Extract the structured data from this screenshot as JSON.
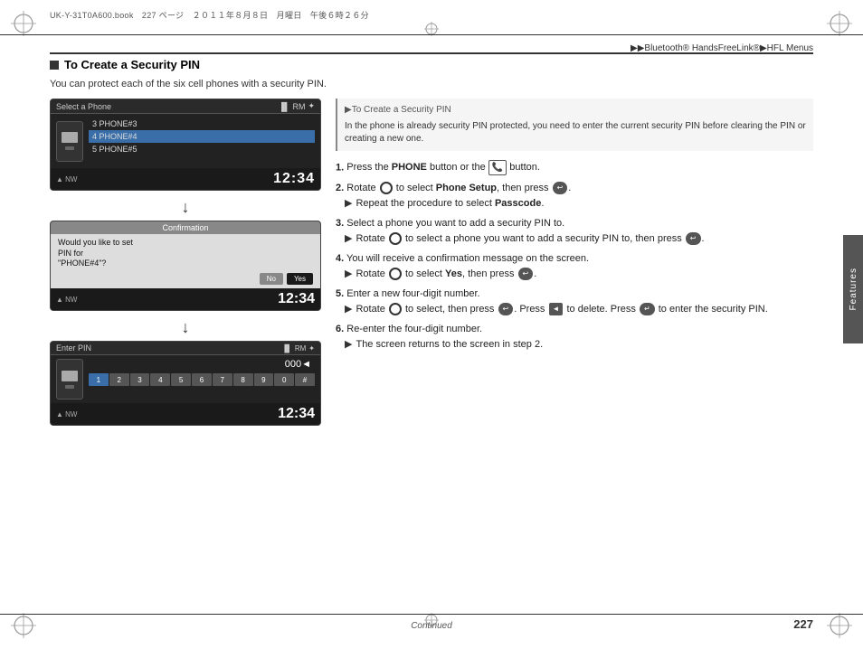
{
  "page": {
    "file_path": "UK-Y-31T0A600.book　227 ページ　２０１１年８月８日　月曜日　午後６時２６分",
    "header_breadcrumb": "▶▶Bluetooth® HandsFreeLink®▶HFL Menus",
    "page_number": "227",
    "continued_label": "Continued"
  },
  "section": {
    "title": "To Create a Security PIN",
    "intro": "You can protect each of the six cell phones with a security PIN."
  },
  "side_note": {
    "title": "▶To Create a Security PIN",
    "body": "In the phone is already security PIN protected, you need to enter the current security PIN before clearing the PIN or creating a new one."
  },
  "screens": {
    "select_phone": {
      "title": "Select a Phone",
      "icons_right": "RM Bluetooth",
      "items": [
        {
          "label": "3 PHONE#3",
          "selected": false
        },
        {
          "label": "4 PHONE#4",
          "selected": true
        },
        {
          "label": "5 PHONE#5",
          "selected": false
        }
      ],
      "footer_nav": "▲ NW",
      "footer_time": "12:34"
    },
    "confirmation": {
      "header": "Confirmation",
      "body_line1": "Would you like to set",
      "body_line2": "PIN for",
      "body_line3": "\"PHONE#4\"?",
      "button_no": "No",
      "button_yes": "Yes",
      "footer_nav": "▲ NW",
      "footer_time": "12:34"
    },
    "enter_pin": {
      "title": "Enter PIN",
      "icons_right": "RM Bluetooth",
      "pin_display": "000◄",
      "footer_nav": "▲ NW",
      "footer_time": "12:34",
      "numpad": [
        "1",
        "2",
        "3",
        "4",
        "5",
        "6",
        "7",
        "8",
        "9",
        "0",
        "#"
      ]
    }
  },
  "steps": [
    {
      "num": "1.",
      "text": "Press the PHONE button or the",
      "bold_word": "PHONE",
      "continuation": " button.",
      "sub": null
    },
    {
      "num": "2.",
      "text": "Rotate",
      "bold_word": "Phone Setup",
      "continuation": ", then press",
      "sub": "Repeat the procedure to select Passcode.",
      "sub_bold": "Passcode"
    },
    {
      "num": "3.",
      "text": "Select a phone you want to add a security PIN to.",
      "sub": "Rotate to select a phone you want to add a security PIN to, then press"
    },
    {
      "num": "4.",
      "text": "You will receive a confirmation message on the screen.",
      "sub": "Rotate to select Yes, then press"
    },
    {
      "num": "5.",
      "text": "Enter a new four-digit number.",
      "sub": "Rotate to select, then press. Press to delete. Press to enter the security PIN."
    },
    {
      "num": "6.",
      "text": "Re-enter the four-digit number.",
      "sub": "The screen returns to the screen in step 2."
    }
  ],
  "side_tab": {
    "label": "Features"
  }
}
